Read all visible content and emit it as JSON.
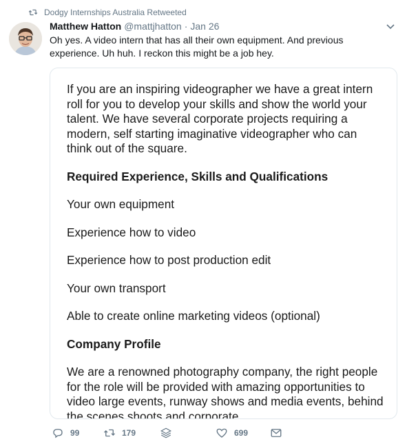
{
  "retweet": {
    "label": "Dodgy Internships Australia Retweeted",
    "icon": "retweet-icon"
  },
  "tweet": {
    "name": "Matthew Hatton",
    "handle": "@mattjhatton",
    "separator": "·",
    "date": "Jan 26",
    "text": "Oh yes. A video intern that has all their own equipment. And previous experience. Uh huh. I reckon this might be a job hey."
  },
  "card": {
    "intro": "If you are an inspiring videographer we have a great intern roll for you to develop your skills and show the world your talent. We have several corporate projects requiring a modern, self starting imaginative videographer who can think out of the square.",
    "heading_requirements": "Required Experience, Skills and Qualifications",
    "requirements": [
      "Your own equipment",
      "Experience how to video",
      "Experience how to post production edit",
      "Your own transport",
      "Able to create online marketing videos (optional)"
    ],
    "heading_company": "Company Profile",
    "company_text": "We are a renowned photography company, the right people for the role will be provided with amazing opportunities to video large events, runway shows and media events, behind the scenes shoots and corporate"
  },
  "actions": {
    "replies": "99",
    "retweets": "179",
    "likes": "699"
  },
  "colors": {
    "text": "#14171a",
    "secondary": "#657786",
    "border": "#e1e8ed"
  }
}
